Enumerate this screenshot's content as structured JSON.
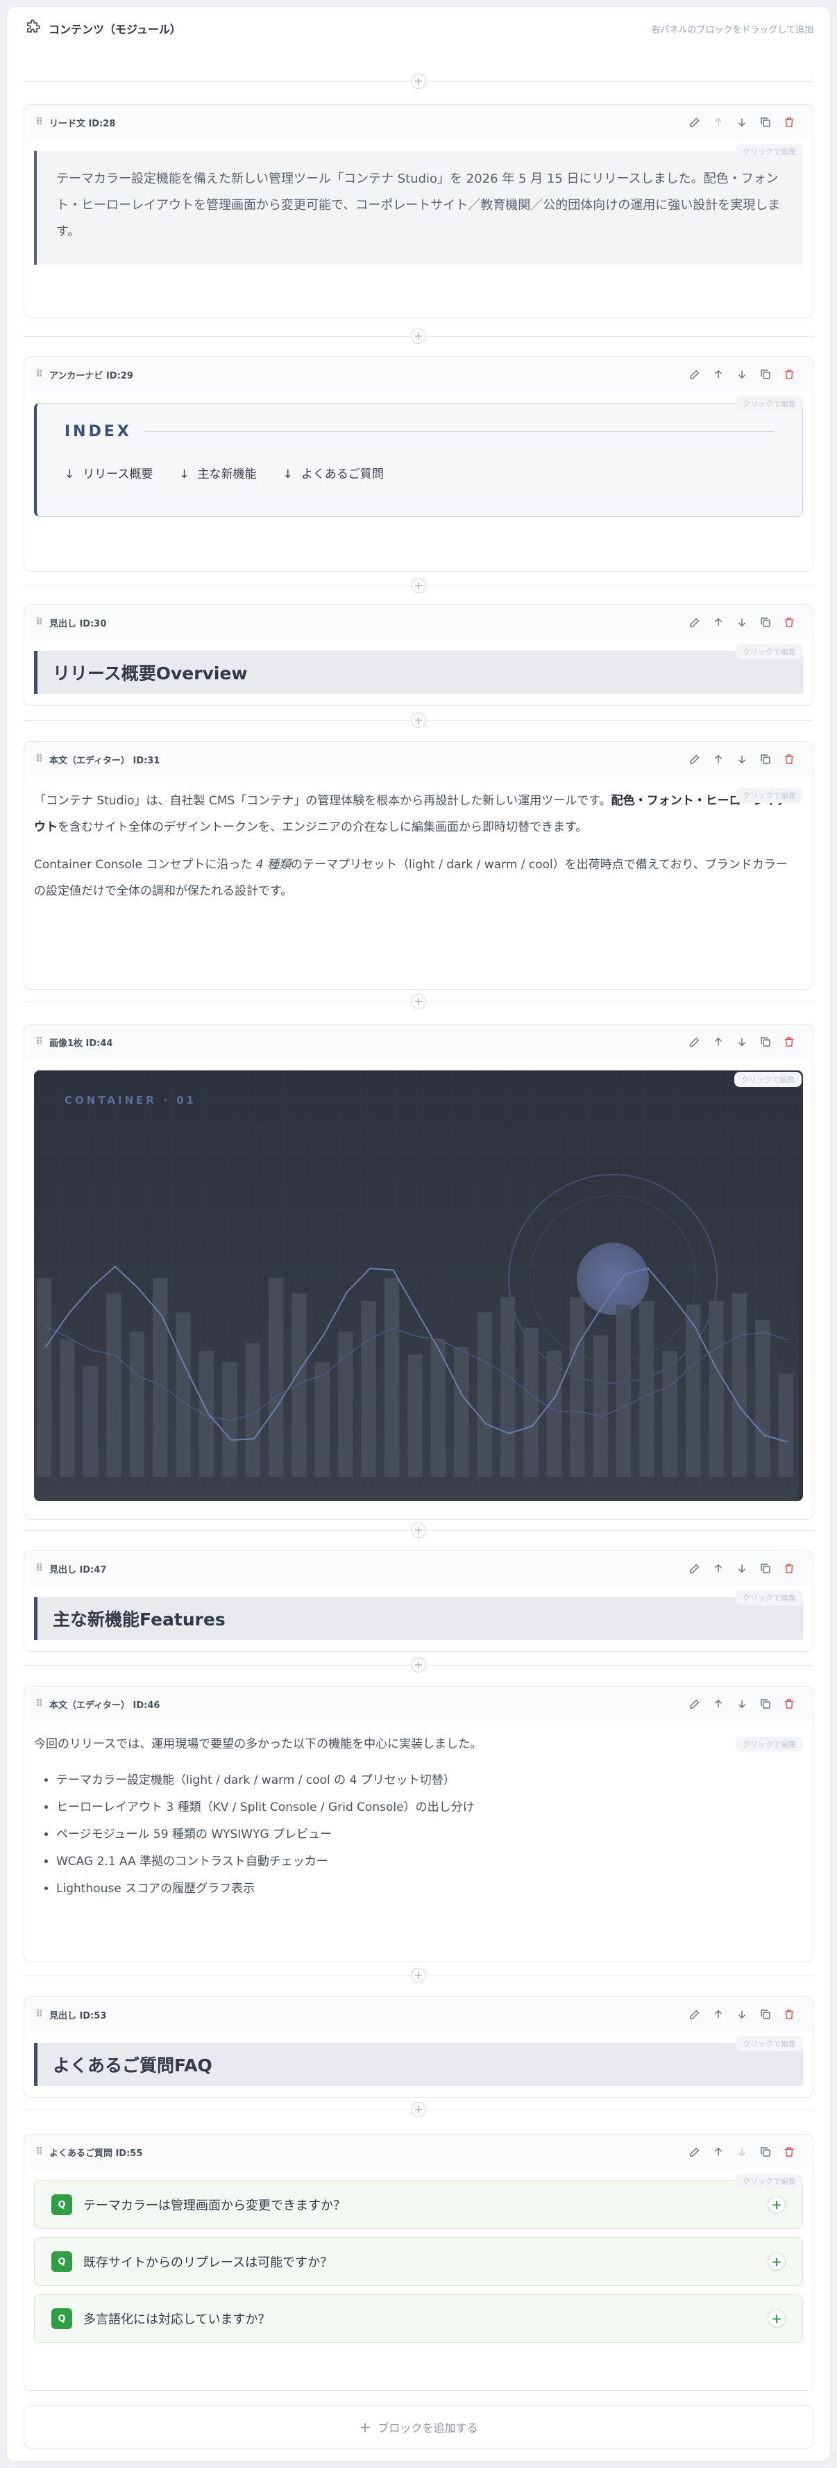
{
  "panel": {
    "title": "コンテンツ（モジュール）",
    "hint": "右パネルのブロックをドラッグして追加",
    "add_block_label": "ブロックを追加する",
    "click_edit": "クリックで編集"
  },
  "blocks": {
    "lead": {
      "label": "リード文 ID:28",
      "text": "テーマカラー設定機能を備えた新しい管理ツール「コンテナ Studio」を 2026 年 5 月 15 日にリリースしました。配色・フォント・ヒーローレイアウトを管理画面から変更可能で、コーポレートサイト／教育機関／公的団体向けの運用に強い設計を実現します。"
    },
    "anchor": {
      "label": "アンカーナビ ID:29",
      "title": "INDEX",
      "links": [
        "リリース概要",
        "主な新機能",
        "よくあるご質問"
      ]
    },
    "heading30": {
      "label": "見出し ID:30",
      "text": "リリース概要Overview"
    },
    "body31": {
      "label": "本文（エディター） ID:31",
      "p1_a": "「コンテナ Studio」は、自社製 CMS「コンテナ」の管理体験を根本から再設計した新しい運用ツールです。",
      "p1_b": "配色・フォント・ヒーローレイアウト",
      "p1_c": "を含むサイト全体のデザイントークンを、エンジニアの介在なしに編集画面から即時切替できます。",
      "p2_a": "Container Console コンセプトに沿った ",
      "p2_b": "4 種類",
      "p2_c": "のテーマプリセット（light / dark / warm / cool）を出荷時点で備えており、ブランドカラーの設定値だけで全体の調和が保たれる設計です。"
    },
    "image44": {
      "label": "画像1枚 ID:44",
      "caption": "CONTAINER · 01"
    },
    "heading47": {
      "label": "見出し ID:47",
      "text": "主な新機能Features"
    },
    "body46": {
      "label": "本文（エディター） ID:46",
      "intro": "今回のリリースでは、運用現場で要望の多かった以下の機能を中心に実装しました。",
      "items": [
        "テーマカラー設定機能（light / dark / warm / cool の 4 プリセット切替）",
        "ヒーローレイアウト 3 種類（KV / Split Console / Grid Console）の出し分け",
        "ページモジュール 59 種類の WYSIWYG プレビュー",
        "WCAG 2.1 AA 準拠のコントラスト自動チェッカー",
        "Lighthouse スコアの履歴グラフ表示"
      ]
    },
    "heading53": {
      "label": "見出し ID:53",
      "text": "よくあるご質問FAQ"
    },
    "faq55": {
      "label": "よくあるご質問 ID:55",
      "badge": "Q",
      "questions": [
        "テーマカラーは管理画面から変更できますか？",
        "既存サイトからのリプレースは可能ですか？",
        "多言語化には対応していますか？"
      ]
    }
  },
  "image_bars": [
    0.52,
    0.36,
    0.29,
    0.48,
    0.38,
    0.52,
    0.43,
    0.33,
    0.3,
    0.35,
    0.52,
    0.48,
    0.3,
    0.38,
    0.46,
    0.52,
    0.32,
    0.36,
    0.34,
    0.43,
    0.47,
    0.39,
    0.33,
    0.47,
    0.37,
    0.45,
    0.46,
    0.33,
    0.45,
    0.46,
    0.48,
    0.41,
    0.27
  ],
  "colors": {
    "accent": "#3b4e78",
    "danger": "#e05555",
    "faq_green": "#2f9e44"
  }
}
